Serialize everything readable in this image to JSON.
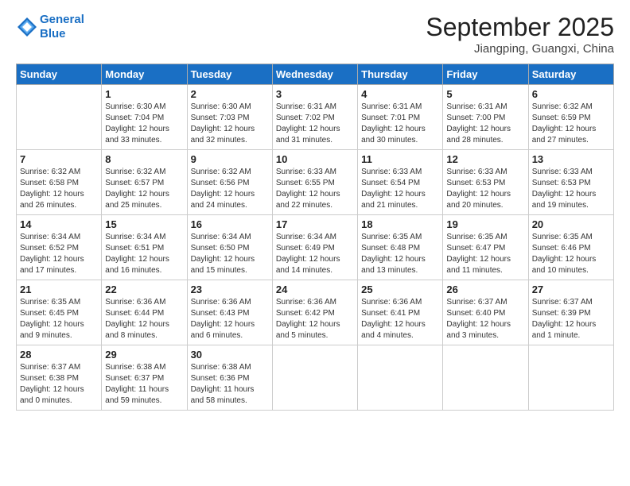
{
  "header": {
    "logo_line1": "General",
    "logo_line2": "Blue",
    "month_title": "September 2025",
    "location": "Jiangping, Guangxi, China"
  },
  "days_of_week": [
    "Sunday",
    "Monday",
    "Tuesday",
    "Wednesday",
    "Thursday",
    "Friday",
    "Saturday"
  ],
  "weeks": [
    [
      {
        "day": "",
        "info": ""
      },
      {
        "day": "1",
        "info": "Sunrise: 6:30 AM\nSunset: 7:04 PM\nDaylight: 12 hours\nand 33 minutes."
      },
      {
        "day": "2",
        "info": "Sunrise: 6:30 AM\nSunset: 7:03 PM\nDaylight: 12 hours\nand 32 minutes."
      },
      {
        "day": "3",
        "info": "Sunrise: 6:31 AM\nSunset: 7:02 PM\nDaylight: 12 hours\nand 31 minutes."
      },
      {
        "day": "4",
        "info": "Sunrise: 6:31 AM\nSunset: 7:01 PM\nDaylight: 12 hours\nand 30 minutes."
      },
      {
        "day": "5",
        "info": "Sunrise: 6:31 AM\nSunset: 7:00 PM\nDaylight: 12 hours\nand 28 minutes."
      },
      {
        "day": "6",
        "info": "Sunrise: 6:32 AM\nSunset: 6:59 PM\nDaylight: 12 hours\nand 27 minutes."
      }
    ],
    [
      {
        "day": "7",
        "info": "Sunrise: 6:32 AM\nSunset: 6:58 PM\nDaylight: 12 hours\nand 26 minutes."
      },
      {
        "day": "8",
        "info": "Sunrise: 6:32 AM\nSunset: 6:57 PM\nDaylight: 12 hours\nand 25 minutes."
      },
      {
        "day": "9",
        "info": "Sunrise: 6:32 AM\nSunset: 6:56 PM\nDaylight: 12 hours\nand 24 minutes."
      },
      {
        "day": "10",
        "info": "Sunrise: 6:33 AM\nSunset: 6:55 PM\nDaylight: 12 hours\nand 22 minutes."
      },
      {
        "day": "11",
        "info": "Sunrise: 6:33 AM\nSunset: 6:54 PM\nDaylight: 12 hours\nand 21 minutes."
      },
      {
        "day": "12",
        "info": "Sunrise: 6:33 AM\nSunset: 6:53 PM\nDaylight: 12 hours\nand 20 minutes."
      },
      {
        "day": "13",
        "info": "Sunrise: 6:33 AM\nSunset: 6:53 PM\nDaylight: 12 hours\nand 19 minutes."
      }
    ],
    [
      {
        "day": "14",
        "info": "Sunrise: 6:34 AM\nSunset: 6:52 PM\nDaylight: 12 hours\nand 17 minutes."
      },
      {
        "day": "15",
        "info": "Sunrise: 6:34 AM\nSunset: 6:51 PM\nDaylight: 12 hours\nand 16 minutes."
      },
      {
        "day": "16",
        "info": "Sunrise: 6:34 AM\nSunset: 6:50 PM\nDaylight: 12 hours\nand 15 minutes."
      },
      {
        "day": "17",
        "info": "Sunrise: 6:34 AM\nSunset: 6:49 PM\nDaylight: 12 hours\nand 14 minutes."
      },
      {
        "day": "18",
        "info": "Sunrise: 6:35 AM\nSunset: 6:48 PM\nDaylight: 12 hours\nand 13 minutes."
      },
      {
        "day": "19",
        "info": "Sunrise: 6:35 AM\nSunset: 6:47 PM\nDaylight: 12 hours\nand 11 minutes."
      },
      {
        "day": "20",
        "info": "Sunrise: 6:35 AM\nSunset: 6:46 PM\nDaylight: 12 hours\nand 10 minutes."
      }
    ],
    [
      {
        "day": "21",
        "info": "Sunrise: 6:35 AM\nSunset: 6:45 PM\nDaylight: 12 hours\nand 9 minutes."
      },
      {
        "day": "22",
        "info": "Sunrise: 6:36 AM\nSunset: 6:44 PM\nDaylight: 12 hours\nand 8 minutes."
      },
      {
        "day": "23",
        "info": "Sunrise: 6:36 AM\nSunset: 6:43 PM\nDaylight: 12 hours\nand 6 minutes."
      },
      {
        "day": "24",
        "info": "Sunrise: 6:36 AM\nSunset: 6:42 PM\nDaylight: 12 hours\nand 5 minutes."
      },
      {
        "day": "25",
        "info": "Sunrise: 6:36 AM\nSunset: 6:41 PM\nDaylight: 12 hours\nand 4 minutes."
      },
      {
        "day": "26",
        "info": "Sunrise: 6:37 AM\nSunset: 6:40 PM\nDaylight: 12 hours\nand 3 minutes."
      },
      {
        "day": "27",
        "info": "Sunrise: 6:37 AM\nSunset: 6:39 PM\nDaylight: 12 hours\nand 1 minute."
      }
    ],
    [
      {
        "day": "28",
        "info": "Sunrise: 6:37 AM\nSunset: 6:38 PM\nDaylight: 12 hours\nand 0 minutes."
      },
      {
        "day": "29",
        "info": "Sunrise: 6:38 AM\nSunset: 6:37 PM\nDaylight: 11 hours\nand 59 minutes."
      },
      {
        "day": "30",
        "info": "Sunrise: 6:38 AM\nSunset: 6:36 PM\nDaylight: 11 hours\nand 58 minutes."
      },
      {
        "day": "",
        "info": ""
      },
      {
        "day": "",
        "info": ""
      },
      {
        "day": "",
        "info": ""
      },
      {
        "day": "",
        "info": ""
      }
    ]
  ]
}
